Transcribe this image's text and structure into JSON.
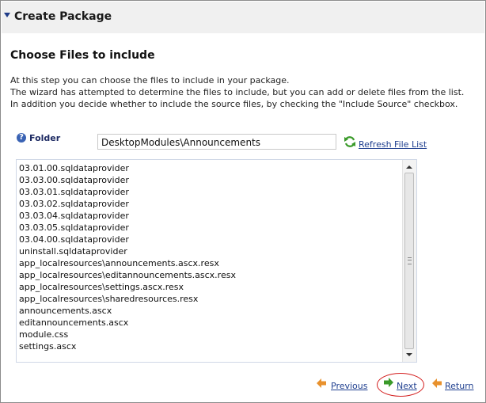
{
  "header": {
    "title": "Create Package",
    "icon": "chevron-down-icon"
  },
  "section": {
    "title": "Choose Files to include",
    "description": [
      "At this step you can choose the files to include in your package.",
      "The wizard has attempted to determine the files to include, but you can add or delete files from the list.",
      "In addition you decide whether to include the source files, by checking the \"Include Source\" checkbox."
    ]
  },
  "folder": {
    "label": "Folder",
    "value": "DesktopModules\\Announcements",
    "help_icon": "help-icon",
    "refresh_label": "Refresh File List",
    "refresh_icon": "refresh-icon"
  },
  "files": [
    "03.01.00.sqldataprovider",
    "03.03.00.sqldataprovider",
    "03.03.01.sqldataprovider",
    "03.03.02.sqldataprovider",
    "03.03.04.sqldataprovider",
    "03.03.05.sqldataprovider",
    "03.04.00.sqldataprovider",
    "uninstall.sqldataprovider",
    "app_localresources\\announcements.ascx.resx",
    "app_localresources\\editannouncements.ascx.resx",
    "app_localresources\\settings.ascx.resx",
    "app_localresources\\sharedresources.resx",
    "announcements.ascx",
    "editannouncements.ascx",
    "module.css",
    "settings.ascx"
  ],
  "nav": {
    "previous_label": "Previous",
    "next_label": "Next",
    "return_label": "Return"
  },
  "colors": {
    "link": "#1f3f8f",
    "highlight_ring": "#d42020",
    "refresh_green": "#3a9a2a",
    "nav_orange": "#e8912d"
  }
}
